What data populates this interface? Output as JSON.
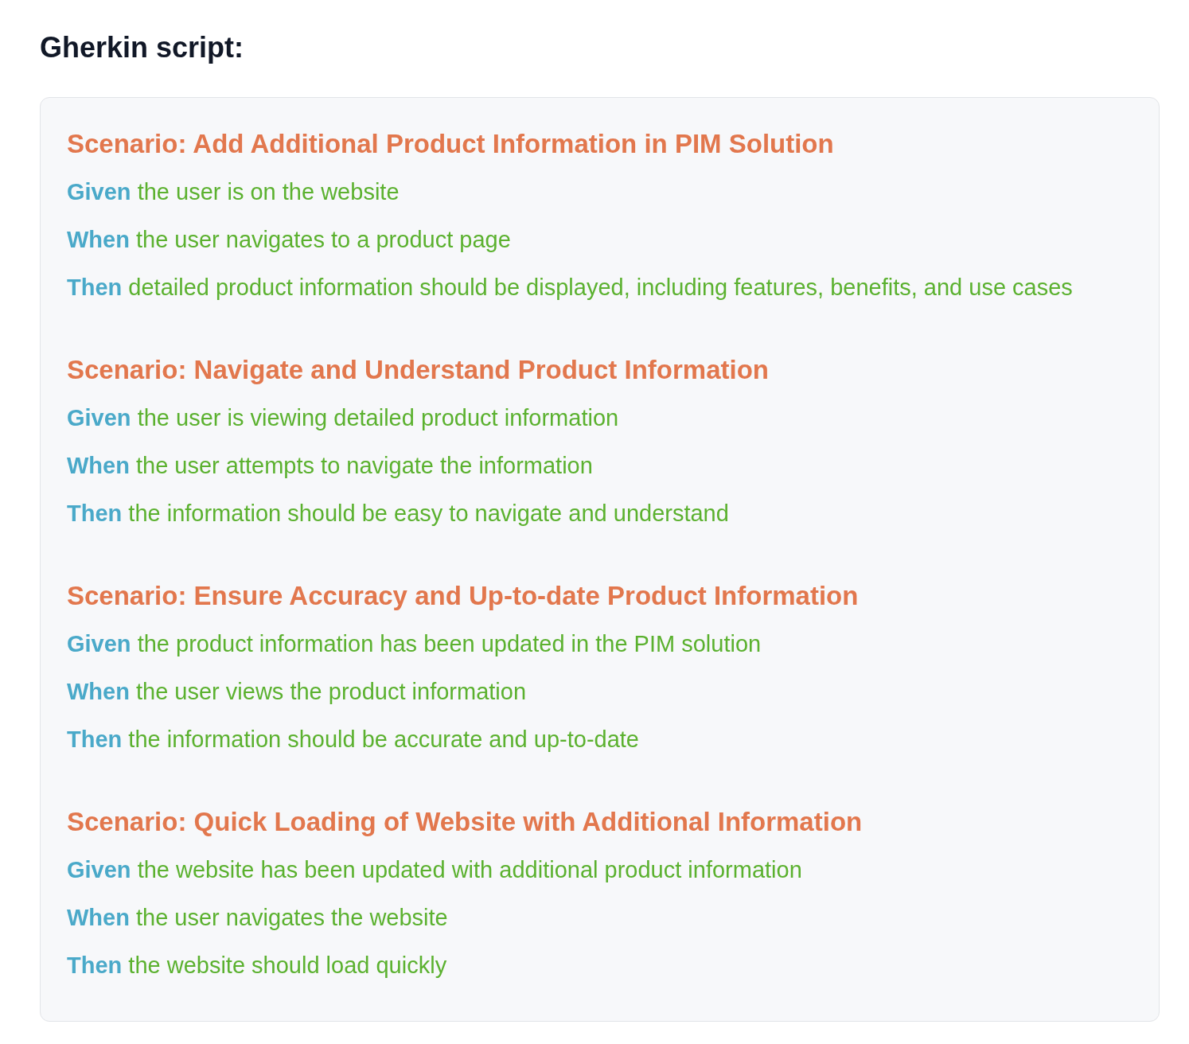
{
  "heading": "Gherkin script:",
  "scenarios": [
    {
      "title": "Scenario: Add Additional Product Information in PIM Solution",
      "steps": [
        {
          "keyword": "Given",
          "text": "the user is on the website"
        },
        {
          "keyword": "When",
          "text": "the user navigates to a product page"
        },
        {
          "keyword": "Then",
          "text": "detailed product information should be displayed, including features, benefits, and use cases"
        }
      ]
    },
    {
      "title": "Scenario: Navigate and Understand Product Information",
      "steps": [
        {
          "keyword": "Given",
          "text": "the user is viewing detailed product information"
        },
        {
          "keyword": "When",
          "text": "the user attempts to navigate the information"
        },
        {
          "keyword": "Then",
          "text": "the information should be easy to navigate and understand"
        }
      ]
    },
    {
      "title": "Scenario: Ensure Accuracy and Up-to-date Product Information",
      "steps": [
        {
          "keyword": "Given",
          "text": "the product information has been updated in the PIM solution"
        },
        {
          "keyword": "When",
          "text": "the user views the product information"
        },
        {
          "keyword": "Then",
          "text": "the information should be accurate and up-to-date"
        }
      ]
    },
    {
      "title": "Scenario: Quick Loading of Website with Additional Information",
      "steps": [
        {
          "keyword": "Given",
          "text": "the website has been updated with additional product information"
        },
        {
          "keyword": "When",
          "text": "the user navigates the website"
        },
        {
          "keyword": "Then",
          "text": "the website should load quickly"
        }
      ]
    }
  ]
}
